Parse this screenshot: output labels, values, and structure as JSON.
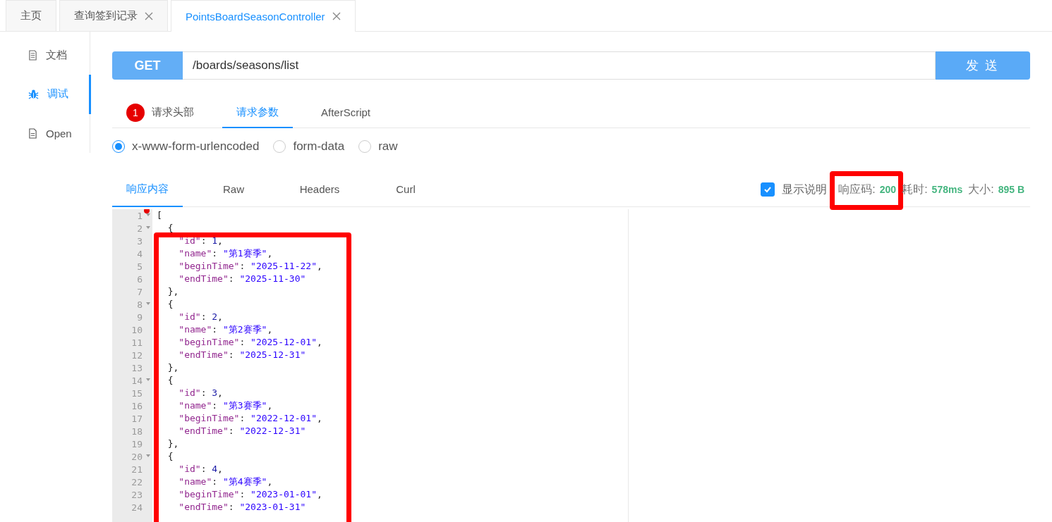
{
  "tabs": [
    {
      "label": "主页",
      "closable": false,
      "selected": false
    },
    {
      "label": "查询签到记录",
      "closable": true,
      "selected": false
    },
    {
      "label": "PointsBoardSeasonController",
      "closable": true,
      "selected": true
    }
  ],
  "sidebar": {
    "items": [
      {
        "kind": "doc",
        "label": "文档",
        "selected": false
      },
      {
        "kind": "debug",
        "label": "调试",
        "selected": true
      },
      {
        "kind": "file",
        "label": "Open",
        "selected": false
      }
    ]
  },
  "request": {
    "method": "GET",
    "url": "/boards/seasons/list",
    "send": "发 送"
  },
  "request_tabs": [
    {
      "label": "请求头部",
      "badge": "1",
      "selected": false
    },
    {
      "label": "请求参数",
      "selected": true
    },
    {
      "label": "AfterScript",
      "selected": false
    }
  ],
  "body_types": [
    {
      "label": "x-www-form-urlencoded",
      "selected": true
    },
    {
      "label": "form-data",
      "selected": false
    },
    {
      "label": "raw",
      "selected": false
    }
  ],
  "response_tabs": [
    {
      "label": "响应内容",
      "selected": true
    },
    {
      "label": "Raw",
      "selected": false
    },
    {
      "label": "Headers",
      "selected": false
    },
    {
      "label": "Curl",
      "selected": false
    }
  ],
  "show_description": {
    "label": "显示说明",
    "checked": true
  },
  "stats": [
    {
      "label": "响应码:",
      "value": "200",
      "highlighted": true
    },
    {
      "label": "耗时:",
      "value": "578ms",
      "highlighted": false
    },
    {
      "label": "大小:",
      "value": "895 B",
      "highlighted": false
    }
  ],
  "editor": {
    "highlighted": true,
    "lines": [
      {
        "no": "1",
        "fold": true,
        "breakpoint": true,
        "parts": [
          {
            "kind": "punct",
            "text": "["
          }
        ]
      },
      {
        "no": "2",
        "fold": true,
        "breakpoint": false,
        "parts": [
          {
            "kind": "punct",
            "text": "  {"
          }
        ]
      },
      {
        "no": "3",
        "fold": false,
        "breakpoint": false,
        "parts": [
          {
            "kind": "key",
            "text": "    \"id\""
          },
          {
            "kind": "punct",
            "text": ": "
          },
          {
            "kind": "num",
            "text": "1"
          },
          {
            "kind": "punct",
            "text": ","
          }
        ]
      },
      {
        "no": "4",
        "fold": false,
        "breakpoint": false,
        "parts": [
          {
            "kind": "key",
            "text": "    \"name\""
          },
          {
            "kind": "punct",
            "text": ": "
          },
          {
            "kind": "str",
            "text": "\"第1赛季\""
          },
          {
            "kind": "punct",
            "text": ","
          }
        ]
      },
      {
        "no": "5",
        "fold": false,
        "breakpoint": false,
        "parts": [
          {
            "kind": "key",
            "text": "    \"beginTime\""
          },
          {
            "kind": "punct",
            "text": ": "
          },
          {
            "kind": "str",
            "text": "\"2025-11-22\""
          },
          {
            "kind": "punct",
            "text": ","
          }
        ]
      },
      {
        "no": "6",
        "fold": false,
        "breakpoint": false,
        "parts": [
          {
            "kind": "key",
            "text": "    \"endTime\""
          },
          {
            "kind": "punct",
            "text": ": "
          },
          {
            "kind": "str",
            "text": "\"2025-11-30\""
          }
        ]
      },
      {
        "no": "7",
        "fold": false,
        "breakpoint": false,
        "parts": [
          {
            "kind": "punct",
            "text": "  },"
          }
        ]
      },
      {
        "no": "8",
        "fold": true,
        "breakpoint": false,
        "parts": [
          {
            "kind": "punct",
            "text": "  {"
          }
        ]
      },
      {
        "no": "9",
        "fold": false,
        "breakpoint": false,
        "parts": [
          {
            "kind": "key",
            "text": "    \"id\""
          },
          {
            "kind": "punct",
            "text": ": "
          },
          {
            "kind": "num",
            "text": "2"
          },
          {
            "kind": "punct",
            "text": ","
          }
        ]
      },
      {
        "no": "10",
        "fold": false,
        "breakpoint": false,
        "parts": [
          {
            "kind": "key",
            "text": "    \"name\""
          },
          {
            "kind": "punct",
            "text": ": "
          },
          {
            "kind": "str",
            "text": "\"第2赛季\""
          },
          {
            "kind": "punct",
            "text": ","
          }
        ]
      },
      {
        "no": "11",
        "fold": false,
        "breakpoint": false,
        "parts": [
          {
            "kind": "key",
            "text": "    \"beginTime\""
          },
          {
            "kind": "punct",
            "text": ": "
          },
          {
            "kind": "str",
            "text": "\"2025-12-01\""
          },
          {
            "kind": "punct",
            "text": ","
          }
        ]
      },
      {
        "no": "12",
        "fold": false,
        "breakpoint": false,
        "parts": [
          {
            "kind": "key",
            "text": "    \"endTime\""
          },
          {
            "kind": "punct",
            "text": ": "
          },
          {
            "kind": "str",
            "text": "\"2025-12-31\""
          }
        ]
      },
      {
        "no": "13",
        "fold": false,
        "breakpoint": false,
        "parts": [
          {
            "kind": "punct",
            "text": "  },"
          }
        ]
      },
      {
        "no": "14",
        "fold": true,
        "breakpoint": false,
        "parts": [
          {
            "kind": "punct",
            "text": "  {"
          }
        ]
      },
      {
        "no": "15",
        "fold": false,
        "breakpoint": false,
        "parts": [
          {
            "kind": "key",
            "text": "    \"id\""
          },
          {
            "kind": "punct",
            "text": ": "
          },
          {
            "kind": "num",
            "text": "3"
          },
          {
            "kind": "punct",
            "text": ","
          }
        ]
      },
      {
        "no": "16",
        "fold": false,
        "breakpoint": false,
        "parts": [
          {
            "kind": "key",
            "text": "    \"name\""
          },
          {
            "kind": "punct",
            "text": ": "
          },
          {
            "kind": "str",
            "text": "\"第3赛季\""
          },
          {
            "kind": "punct",
            "text": ","
          }
        ]
      },
      {
        "no": "17",
        "fold": false,
        "breakpoint": false,
        "parts": [
          {
            "kind": "key",
            "text": "    \"beginTime\""
          },
          {
            "kind": "punct",
            "text": ": "
          },
          {
            "kind": "str",
            "text": "\"2022-12-01\""
          },
          {
            "kind": "punct",
            "text": ","
          }
        ]
      },
      {
        "no": "18",
        "fold": false,
        "breakpoint": false,
        "parts": [
          {
            "kind": "key",
            "text": "    \"endTime\""
          },
          {
            "kind": "punct",
            "text": ": "
          },
          {
            "kind": "str",
            "text": "\"2022-12-31\""
          }
        ]
      },
      {
        "no": "19",
        "fold": false,
        "breakpoint": false,
        "parts": [
          {
            "kind": "punct",
            "text": "  },"
          }
        ]
      },
      {
        "no": "20",
        "fold": true,
        "breakpoint": false,
        "parts": [
          {
            "kind": "punct",
            "text": "  {"
          }
        ]
      },
      {
        "no": "21",
        "fold": false,
        "breakpoint": false,
        "parts": [
          {
            "kind": "key",
            "text": "    \"id\""
          },
          {
            "kind": "punct",
            "text": ": "
          },
          {
            "kind": "num",
            "text": "4"
          },
          {
            "kind": "punct",
            "text": ","
          }
        ]
      },
      {
        "no": "22",
        "fold": false,
        "breakpoint": false,
        "parts": [
          {
            "kind": "key",
            "text": "    \"name\""
          },
          {
            "kind": "punct",
            "text": ": "
          },
          {
            "kind": "str",
            "text": "\"第4赛季\""
          },
          {
            "kind": "punct",
            "text": ","
          }
        ]
      },
      {
        "no": "23",
        "fold": false,
        "breakpoint": false,
        "parts": [
          {
            "kind": "key",
            "text": "    \"beginTime\""
          },
          {
            "kind": "punct",
            "text": ": "
          },
          {
            "kind": "str",
            "text": "\"2023-01-01\""
          },
          {
            "kind": "punct",
            "text": ","
          }
        ]
      },
      {
        "no": "24",
        "fold": false,
        "breakpoint": false,
        "parts": [
          {
            "kind": "key",
            "text": "    \"endTime\""
          },
          {
            "kind": "punct",
            "text": ": "
          },
          {
            "kind": "str",
            "text": "\"2023-01-31\""
          }
        ]
      }
    ]
  }
}
